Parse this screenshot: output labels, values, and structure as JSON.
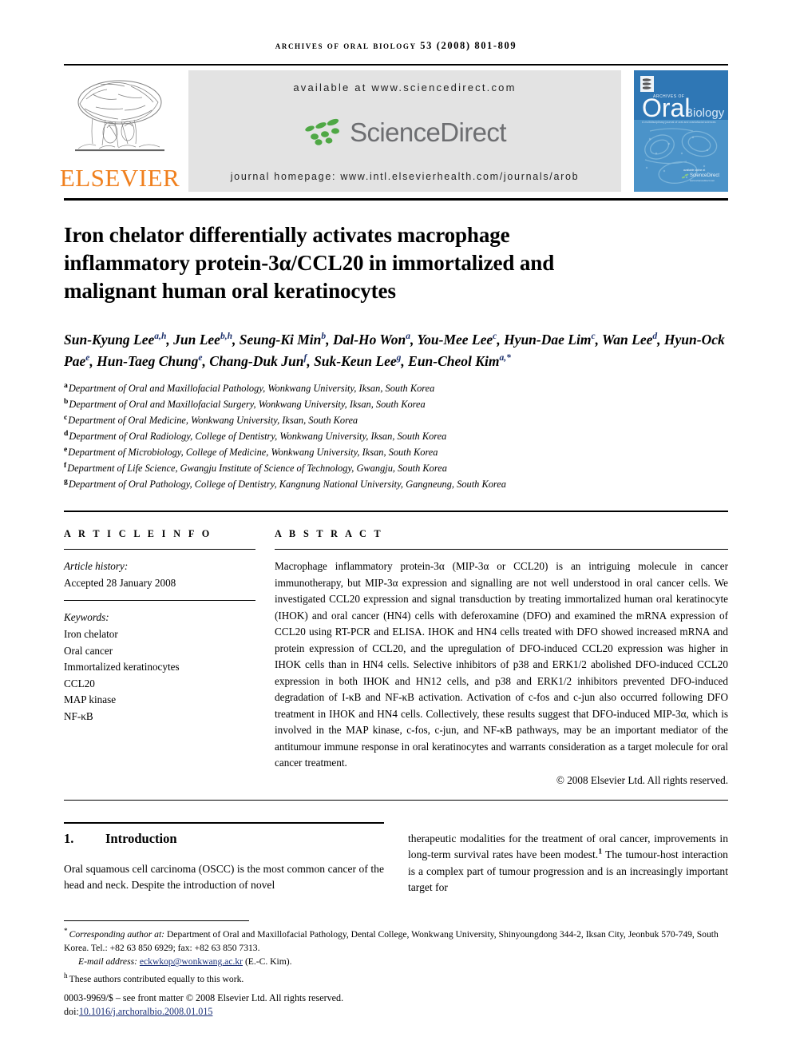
{
  "running_head": {
    "journal": "ARCHIVES OF ORAL BIOLOGY",
    "volume_year_pages": "53 (2008) 801-809"
  },
  "masthead": {
    "publisher": "ELSEVIER",
    "available_at": "available at www.sciencedirect.com",
    "sciencedirect_wordmark": "ScienceDirect",
    "journal_homepage": "journal homepage: www.intl.elsevierhealth.com/journals/arob",
    "cover_title_small": "ARCHIVES OF",
    "cover_title_main": "Oral",
    "cover_title_sub": "Biology",
    "cover_tagline": "A multidisciplinary journal of oral and craniofacial sciences",
    "cover_badge": "ScienceDirect",
    "colors": {
      "elsevier_orange": "#f0801e",
      "sd_gray": "#6d6e71",
      "sd_green": "#4fa845",
      "cover_blue": "#2b6cb0",
      "band_gray": "#e3e3e3"
    }
  },
  "article": {
    "title_lines": [
      "Iron chelator differentially activates macrophage",
      "inflammatory protein-3α/CCL20 in immortalized and",
      "malignant human oral keratinocytes"
    ],
    "authors_html": "Sun-Kyung Lee<sup>a,h</sup>, Jun Lee<sup>b,h</sup>, Seung-Ki Min<sup>b</sup>, Dal-Ho Won<sup>a</sup>, You-Mee Lee<sup>c</sup>, Hyun-Dae Lim<sup>c</sup>, Wan Lee<sup>d</sup>, Hyun-Ock Pae<sup>e</sup>, Hun-Taeg Chung<sup>e</sup>, Chang-Duk Jun<sup>f</sup>, Suk-Keun Lee<sup>g</sup>, Eun-Cheol Kim<sup>a,*</sup>",
    "affiliations": [
      {
        "marker": "a",
        "text": "Department of Oral and Maxillofacial Pathology, Wonkwang University, Iksan, South Korea"
      },
      {
        "marker": "b",
        "text": "Department of Oral and Maxillofacial Surgery, Wonkwang University, Iksan, South Korea"
      },
      {
        "marker": "c",
        "text": "Department of Oral Medicine, Wonkwang University, Iksan, South Korea"
      },
      {
        "marker": "d",
        "text": "Department of Oral Radiology, College of Dentistry, Wonkwang University, Iksan, South Korea"
      },
      {
        "marker": "e",
        "text": "Department of Microbiology, College of Medicine, Wonkwang University, Iksan, South Korea"
      },
      {
        "marker": "f",
        "text": "Department of Life Science, Gwangju Institute of Science of Technology, Gwangju, South Korea"
      },
      {
        "marker": "g",
        "text": "Department of Oral Pathology, College of Dentistry, Kangnung National University, Gangneung, South Korea"
      }
    ]
  },
  "article_info": {
    "heading": "A R T I C L E   I N F O",
    "history_label": "Article history:",
    "history_value": "Accepted 28 January 2008",
    "keywords_label": "Keywords:",
    "keywords": [
      "Iron chelator",
      "Oral cancer",
      "Immortalized keratinocytes",
      "CCL20",
      "MAP kinase",
      "NF-κB"
    ]
  },
  "abstract": {
    "heading": "A B S T R A C T",
    "text": "Macrophage inflammatory protein-3α (MIP-3α or CCL20) is an intriguing molecule in cancer immunotherapy, but MIP-3α expression and signalling are not well understood in oral cancer cells. We investigated CCL20 expression and signal transduction by treating immortalized human oral keratinocyte (IHOK) and oral cancer (HN4) cells with deferoxamine (DFO) and examined the mRNA expression of CCL20 using RT-PCR and ELISA. IHOK and HN4 cells treated with DFO showed increased mRNA and protein expression of CCL20, and the upregulation of DFO-induced CCL20 expression was higher in IHOK cells than in HN4 cells. Selective inhibitors of p38 and ERK1/2 abolished DFO-induced CCL20 expression in both IHOK and HN12 cells, and p38 and ERK1/2 inhibitors prevented DFO-induced degradation of I-κB and NF-κB activation. Activation of c-fos and c-jun also occurred following DFO treatment in IHOK and HN4 cells. Collectively, these results suggest that DFO-induced MIP-3α, which is involved in the MAP kinase, c-fos, c-jun, and NF-κB pathways, may be an important mediator of the antitumour immune response in oral keratinocytes and warrants consideration as a target molecule for oral cancer treatment.",
    "copyright": "© 2008 Elsevier Ltd. All rights reserved."
  },
  "body": {
    "section_number": "1.",
    "section_title": "Introduction",
    "left_column_text": "Oral squamous cell carcinoma (OSCC) is the most common cancer of the head and neck. Despite the introduction of novel",
    "right_column_html": "therapeutic modalities for the treatment of oral cancer, improvements in long-term survival rates have been modest.<sup>1</sup> The tumour-host interaction is a complex part of tumour progression and is an increasingly important target for"
  },
  "footnotes": {
    "corresponding_marker": "*",
    "corresponding_label": "Corresponding author at:",
    "corresponding_text": "Department of Oral and Maxillofacial Pathology, Dental College, Wonkwang University, Shinyoungdong 344-2, Iksan City, Jeonbuk 570-749, South Korea. Tel.: +82 63 850 6929; fax: +82 63 850 7313.",
    "email_label": "E-mail address:",
    "email_address": "eckwkop@wonkwang.ac.kr",
    "email_suffix": "(E.-C. Kim).",
    "equal_marker": "h",
    "equal_text": "These authors contributed equally to this work.",
    "issn_line": "0003-9969/$ – see front matter © 2008 Elsevier Ltd. All rights reserved.",
    "doi_label": "doi:",
    "doi_value": "10.1016/j.archoralbio.2008.01.015"
  }
}
